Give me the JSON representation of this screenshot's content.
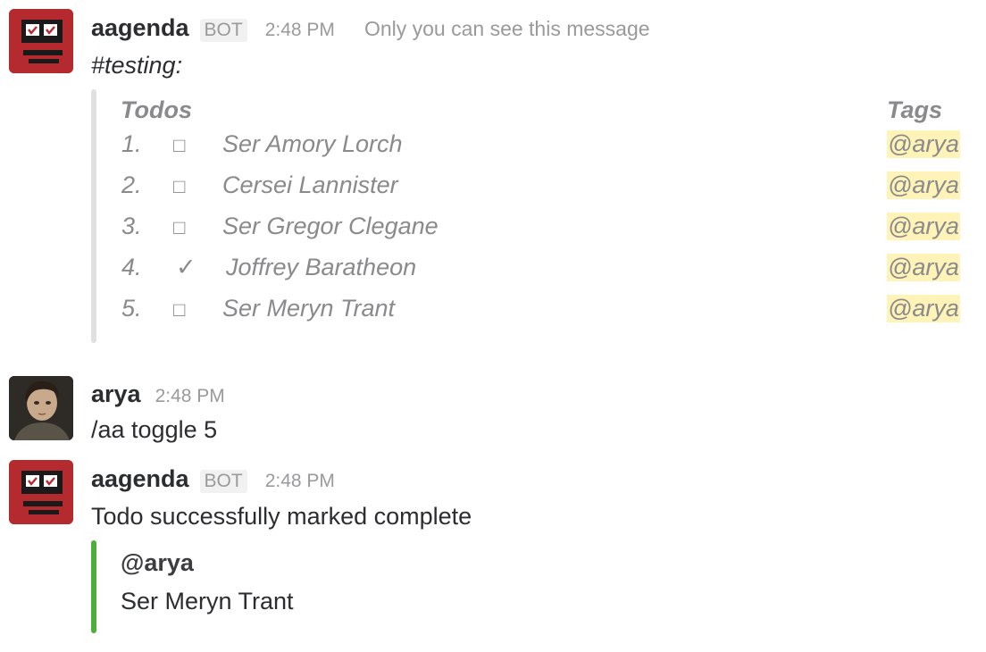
{
  "messages": [
    {
      "author": "aagenda",
      "badge": "BOT",
      "time": "2:48 PM",
      "ephemeral_note": "Only you can see this message",
      "channel_line": "#testing:",
      "table": {
        "col_todos": "Todos",
        "col_tags": "Tags",
        "rows": [
          {
            "num": "1.",
            "check": "□",
            "text": "Ser Amory Lorch",
            "tag": "@arya"
          },
          {
            "num": "2.",
            "check": "□",
            "text": "Cersei Lannister",
            "tag": "@arya"
          },
          {
            "num": "3.",
            "check": "□",
            "text": "Ser Gregor Clegane",
            "tag": "@arya"
          },
          {
            "num": "4.",
            "check": "✓",
            "text": "Joffrey Baratheon",
            "tag": "@arya"
          },
          {
            "num": "5.",
            "check": "□",
            "text": "Ser Meryn Trant",
            "tag": "@arya"
          }
        ]
      }
    },
    {
      "author": "arya",
      "time": "2:48 PM",
      "text": "/aa toggle 5"
    },
    {
      "author": "aagenda",
      "badge": "BOT",
      "time": "2:48 PM",
      "text": "Todo successfully marked complete",
      "attachment": {
        "title": "@arya",
        "text": "Ser Meryn Trant",
        "bar_color": "#4caf3a"
      }
    }
  ],
  "colors": {
    "bot_avatar": "#b52a2f",
    "tag_highlight": "#fff3b8",
    "grey_bar": "#e0e0e0",
    "green_bar": "#4caf3a"
  }
}
